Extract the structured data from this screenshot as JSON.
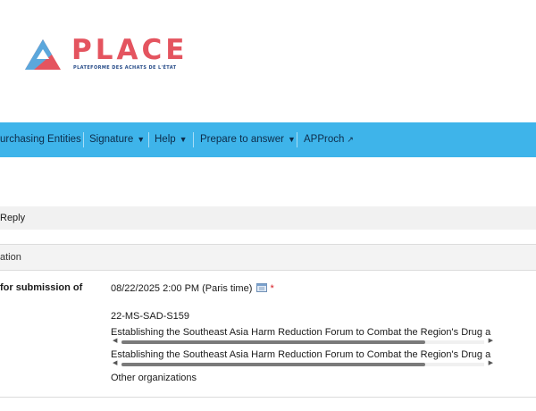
{
  "logo": {
    "name": "PLACE",
    "tagline": "PLATEFORME DES ACHATS DE L'ÉTAT"
  },
  "nav": {
    "items": [
      {
        "label": "urchasing Entities"
      },
      {
        "label": "Signature",
        "icon": "chevron-down-icon"
      },
      {
        "label": "Help",
        "icon": "chevron-down-icon"
      },
      {
        "label": "Prepare to answer",
        "icon": "chevron-down-icon"
      },
      {
        "label": "APProch",
        "icon": "external-link-icon"
      }
    ]
  },
  "reply_bar": {
    "label": "Reply"
  },
  "section": {
    "title": "ation"
  },
  "details": {
    "deadline_label": "for submission of",
    "deadline_value": "08/22/2025 2:00 PM (Paris time)",
    "required_marker": "*",
    "reference": "22-MS-SAD-S159",
    "title_1": "Establishing the Southeast Asia Harm Reduction Forum to Combat the Region's Drug a",
    "title_2": "Establishing the Southeast Asia Harm Reduction Forum to Combat the Region's Drug a",
    "organization": "Other organizations"
  },
  "colors": {
    "navbar": "#3eb4ea",
    "brand_red": "#e4545f",
    "brand_blue": "#254a87"
  }
}
